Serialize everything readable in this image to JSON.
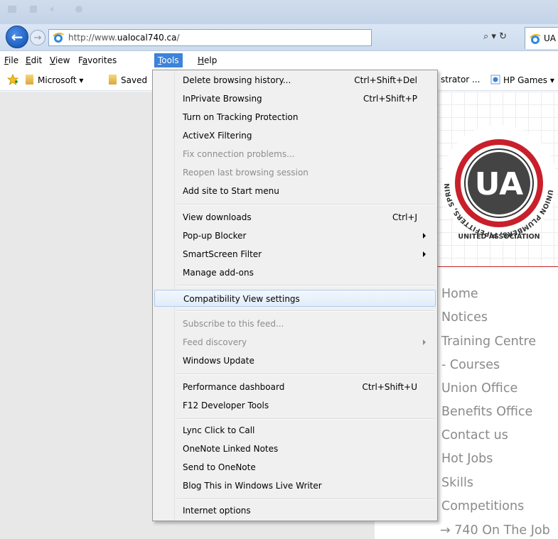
{
  "browser": {
    "url_prefix": "http://www.",
    "url_domain": "ualocal740.ca",
    "url_suffix": "/",
    "search_glyph": "⌕ ▾ ↻",
    "tab_title": "UA"
  },
  "menubar": [
    {
      "key": "F",
      "rest": "ile",
      "name": "menu-file"
    },
    {
      "key": "E",
      "rest": "dit",
      "name": "menu-edit"
    },
    {
      "key": "V",
      "rest": "iew",
      "name": "menu-view"
    },
    {
      "pre": "F",
      "key": "a",
      "rest": "vorites",
      "name": "menu-favorites"
    },
    {
      "key": "T",
      "rest": "ools",
      "name": "menu-tools",
      "active": true
    },
    {
      "key": "H",
      "rest": "elp",
      "name": "menu-help"
    }
  ],
  "favorites": {
    "microsoft": "Microsoft ▾",
    "saved": "Saved",
    "administrator": "strator ...",
    "hp_games": "HP Games ▾"
  },
  "tools_menu": {
    "groups": [
      [
        {
          "label": "Delete browsing history...",
          "shortcut": "Ctrl+Shift+Del"
        },
        {
          "label": "InPrivate Browsing",
          "shortcut": "Ctrl+Shift+P"
        },
        {
          "label": "Turn on Tracking Protection"
        },
        {
          "label": "ActiveX Filtering"
        },
        {
          "label": "Fix connection problems...",
          "disabled": true
        },
        {
          "label": "Reopen last browsing session",
          "disabled": true
        },
        {
          "label": "Add site to Start menu"
        }
      ],
      [
        {
          "label": "View downloads",
          "shortcut": "Ctrl+J"
        },
        {
          "label": "Pop-up Blocker",
          "submenu": true
        },
        {
          "label": "SmartScreen Filter",
          "submenu": true
        },
        {
          "label": "Manage add-ons"
        }
      ],
      [
        {
          "label": "Compatibility View settings",
          "hover": true
        }
      ],
      [
        {
          "label": "Subscribe to this feed...",
          "disabled": true
        },
        {
          "label": "Feed discovery",
          "disabled": true,
          "submenu": true
        },
        {
          "label": "Windows Update"
        }
      ],
      [
        {
          "label": "Performance dashboard",
          "shortcut": "Ctrl+Shift+U"
        },
        {
          "label": "F12 Developer Tools"
        }
      ],
      [
        {
          "label": "Lync Click to Call"
        },
        {
          "label": "OneNote Linked Notes"
        },
        {
          "label": "Send to OneNote"
        },
        {
          "label": "Blog This in Windows Live Writer"
        }
      ],
      [
        {
          "label": "Internet options"
        }
      ]
    ]
  },
  "site_nav": [
    "Home",
    "Notices",
    "Training Centre",
    "- Courses",
    "Union Office",
    "Benefits Office",
    "Contact us",
    "Hot Jobs",
    "Skills",
    "Competitions",
    "→ 740 On The Job"
  ],
  "logo": {
    "ring_text": "UNION PLUMBERS, PIPEFITTERS, SPRINKLERFITTERS & SERVICE TECHS",
    "bottom_text": "UNITED ASSOCIATION",
    "center": "UA",
    "red": "#c8202b"
  }
}
